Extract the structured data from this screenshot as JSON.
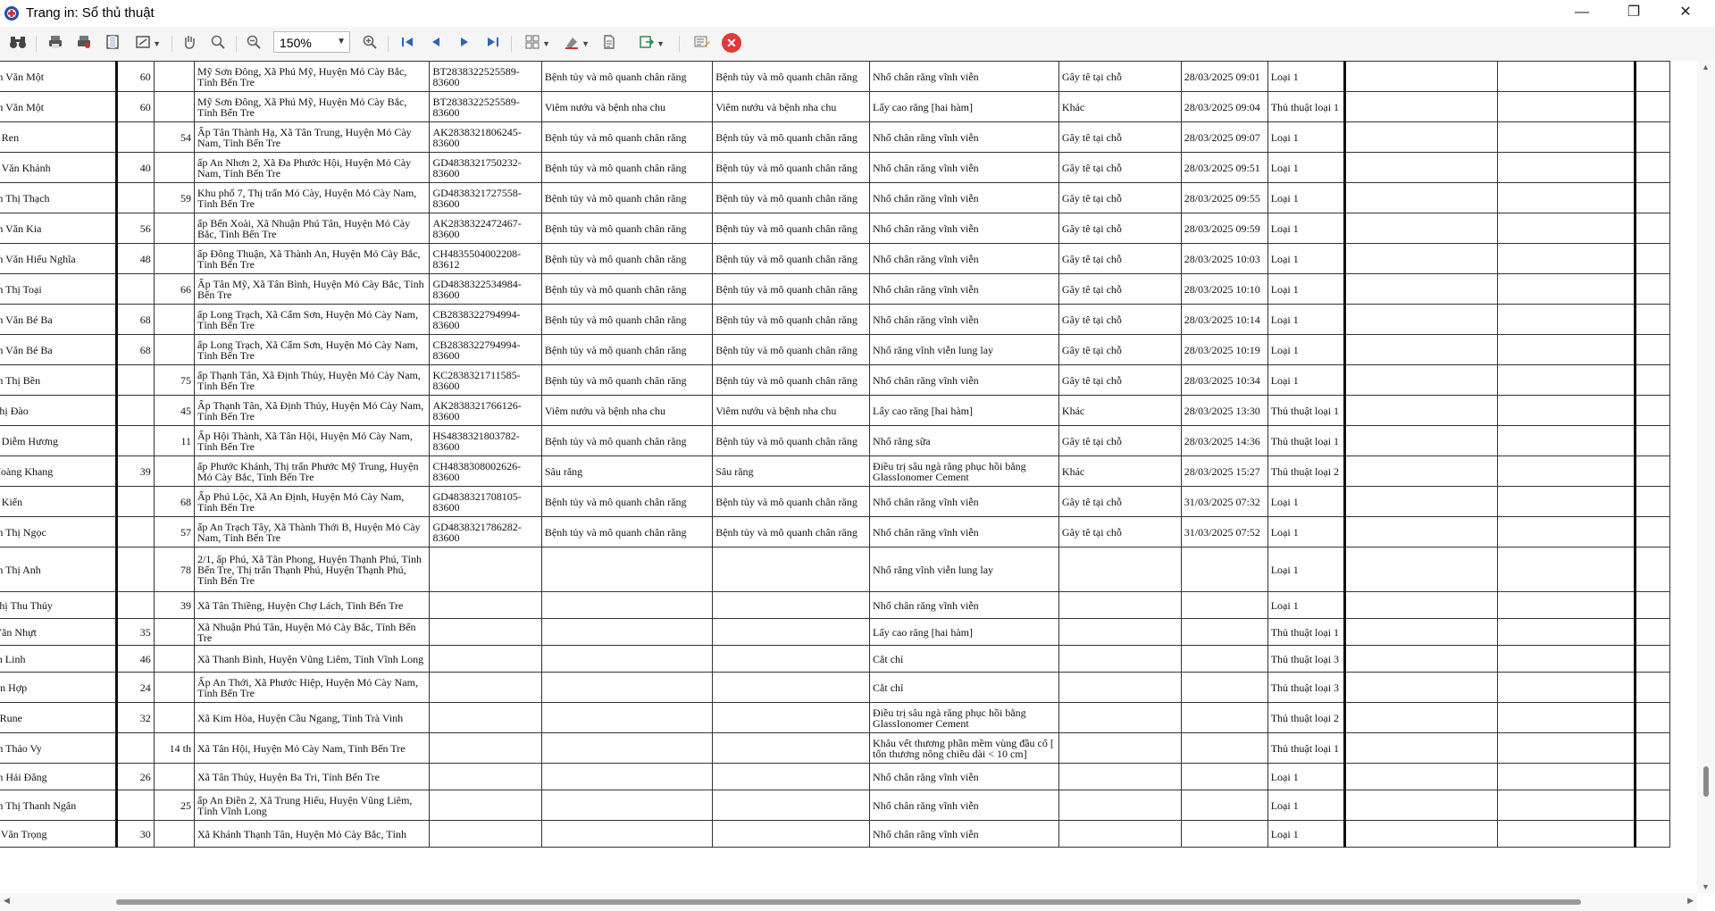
{
  "window": {
    "title": "Trang in: Sổ thủ thuật",
    "minimize": "—",
    "maximize": "❐",
    "close": "✕"
  },
  "toolbar": {
    "zoom_value": "150%",
    "icons": [
      "binoculars-icon",
      "print-icon",
      "print-setup-icon",
      "page-layout-icon",
      "fit-page-icon",
      "hand-icon",
      "zoom-in-icon",
      "zoom-out-icon",
      "zoom-combo",
      "zoom-plus-icon",
      "first-page-icon",
      "prev-page-icon",
      "next-page-icon",
      "last-page-icon",
      "multi-page-icon",
      "color-icon",
      "document-icon",
      "export-icon",
      "parameters-icon",
      "close-icon"
    ]
  },
  "report": {
    "rows": [
      {
        "name": "guyễn Văn Một",
        "age1": "60",
        "age2": "",
        "address": "Mỹ Sơn Đông, Xã Phú Mỹ, Huyện Mỏ Cày Bắc, Tỉnh Bến Tre",
        "card": "BT2838322525589-83600",
        "diag1": "Bệnh tủy và mô quanh chân răng",
        "diag2": "Bệnh tủy và mô quanh chân răng",
        "procedure": "Nhổ chân răng vĩnh viễn",
        "method": "Gây tê tại chỗ",
        "datetime": "28/03/2025 09:01",
        "type": "Loại 1"
      },
      {
        "name": "guyễn Văn Một",
        "age1": "60",
        "age2": "",
        "address": "Mỹ Sơn Đông, Xã Phú Mỹ, Huyện Mỏ Cày Bắc, Tỉnh Bến Tre",
        "card": "BT2838322525589-83600",
        "diag1": "Viêm nướu và bệnh nha chu",
        "diag2": "Viêm nướu và bệnh nha chu",
        "procedure": "Lấy cao răng [hai hàm]",
        "method": "Khác",
        "datetime": "28/03/2025 09:04",
        "type": "Thủ thuật loại 1"
      },
      {
        "name": "ê Thị Ren",
        "age1": "",
        "age2": "54",
        "address": "Ấp Tân Thành Hạ, Xã Tân Trung, Huyện Mỏ Cày Nam, Tỉnh Bến Tre",
        "card": "AK2838321806245-83600",
        "diag1": "Bệnh tủy và mô quanh chân răng",
        "diag2": "Bệnh tủy và mô quanh chân răng",
        "procedure": "Nhổ chân răng vĩnh viễn",
        "method": "Gây tê tại chỗ",
        "datetime": "28/03/2025 09:07",
        "type": "Loại 1"
      },
      {
        "name": "ương Văn Khánh",
        "age1": "40",
        "age2": "",
        "address": "ấp An Nhơn 2, Xã Đa Phước Hội, Huyện Mỏ Cày Nam, Tỉnh Bến Tre",
        "card": "GD4838321750232-83600",
        "diag1": "Bệnh tủy và mô quanh chân răng",
        "diag2": "Bệnh tủy và mô quanh chân răng",
        "procedure": "Nhổ chân răng vĩnh viễn",
        "method": "Gây tê tại chỗ",
        "datetime": "28/03/2025 09:51",
        "type": "Loại 1"
      },
      {
        "name": "guyễn Thị Thạch",
        "age1": "",
        "age2": "59",
        "address": "Khu phố 7, Thị trấn Mỏ Cày, Huyện Mỏ Cày Nam, Tỉnh Bến Tre",
        "card": "GD4838321727558-83600",
        "diag1": "Bệnh tủy và mô quanh chân răng",
        "diag2": "Bệnh tủy và mô quanh chân răng",
        "procedure": "Nhổ chân răng vĩnh viễn",
        "method": "Gây tê tại chỗ",
        "datetime": "28/03/2025 09:55",
        "type": "Loại 1"
      },
      {
        "name": "guyễn Văn Kia",
        "age1": "56",
        "age2": "",
        "address": "ấp Bến Xoài, Xã Nhuận Phú Tân, Huyện Mỏ Cày Bắc, Tỉnh Bến Tre",
        "card": "AK2838322472467-83600",
        "diag1": "Bệnh tủy và mô quanh chân răng",
        "diag2": "Bệnh tủy và mô quanh chân răng",
        "procedure": "Nhổ chân răng vĩnh viễn",
        "method": "Gây tê tại chỗ",
        "datetime": "28/03/2025 09:59",
        "type": "Loại 1"
      },
      {
        "name": "guyễn Văn Hiếu Nghĩa",
        "age1": "48",
        "age2": "",
        "address": "ấp Đông Thuận, Xã Thành An, Huyện Mỏ Cày Bắc, Tỉnh Bến Tre",
        "card": "CH4835504002208-83612",
        "diag1": "Bệnh tủy và mô quanh chân răng",
        "diag2": "Bệnh tủy và mô quanh chân răng",
        "procedure": "Nhổ chân răng vĩnh viễn",
        "method": "Gây tê tại chỗ",
        "datetime": "28/03/2025 10:03",
        "type": "Loại 1"
      },
      {
        "name": "guyễn Thị Toại",
        "age1": "",
        "age2": "66",
        "address": "Ấp Tân Mỹ, Xã Tân Bình, Huyện Mỏ Cày Bắc, Tỉnh Bến Tre",
        "card": "GD4838322534984-83600",
        "diag1": "Bệnh tủy và mô quanh chân răng",
        "diag2": "Bệnh tủy và mô quanh chân răng",
        "procedure": "Nhổ chân răng vĩnh viễn",
        "method": "Gây tê tại chỗ",
        "datetime": "28/03/2025 10:10",
        "type": "Loại 1"
      },
      {
        "name": "guyễn Văn Bé Ba",
        "age1": "68",
        "age2": "",
        "address": "ấp Long Trạch, Xã Cẩm Sơn, Huyện Mỏ Cày Nam, Tỉnh Bến Tre",
        "card": "CB2838322794994-83600",
        "diag1": "Bệnh tủy và mô quanh chân răng",
        "diag2": "Bệnh tủy và mô quanh chân răng",
        "procedure": "Nhổ chân răng vĩnh viễn",
        "method": "Gây tê tại chỗ",
        "datetime": "28/03/2025 10:14",
        "type": "Loại 1"
      },
      {
        "name": "guyễn Văn Bé Ba",
        "age1": "68",
        "age2": "",
        "address": "ấp Long Trạch, Xã Cẩm Sơn, Huyện Mỏ Cày Nam, Tỉnh Bến Tre",
        "card": "CB2838322794994-83600",
        "diag1": "Bệnh tủy và mô quanh chân răng",
        "diag2": "Bệnh tủy và mô quanh chân răng",
        "procedure": "Nhổ răng vĩnh viễn lung lay",
        "method": "Gây tê tại chỗ",
        "datetime": "28/03/2025 10:19",
        "type": "Loại 1"
      },
      {
        "name": "guyễn Thị Bền",
        "age1": "",
        "age2": "75",
        "address": "ấp Thạnh Tân, Xã Định Thủy, Huyện Mỏ Cày Nam, Tỉnh Bến Tre",
        "card": "KC2838321711585-83600",
        "diag1": "Bệnh tủy và mô quanh chân răng",
        "diag2": "Bệnh tủy và mô quanh chân răng",
        "procedure": "Nhổ chân răng vĩnh viễn",
        "method": "Gây tê tại chỗ",
        "datetime": "28/03/2025 10:34",
        "type": "Loại 1"
      },
      {
        "name": "rần Thị Đào",
        "age1": "",
        "age2": "45",
        "address": "Ấp Thạnh Tân, Xã Định Thủy, Huyện Mỏ Cày Nam, Tỉnh Bến Tre",
        "card": "AK2838321766126-83600",
        "diag1": "Viêm nướu và bệnh nha chu",
        "diag2": "Viêm nướu và bệnh nha chu",
        "procedure": "Lấy cao răng [hai hàm]",
        "method": "Khác",
        "datetime": "28/03/2025 13:30",
        "type": "Thủ thuật loại 1"
      },
      {
        "name": "ê Thị Diễm Hương",
        "age1": "",
        "age2": "11",
        "address": "Ấp Hội Thành, Xã Tân Hội, Huyện Mỏ Cày Nam, Tỉnh Bến Tre",
        "card": "HS4838321803782-83600",
        "diag1": "Bệnh tủy và mô quanh chân răng",
        "diag2": "Bệnh tủy và mô quanh chân răng",
        "procedure": "Nhổ răng sữa",
        "method": "Gây tê tại chỗ",
        "datetime": "28/03/2025 14:36",
        "type": "Thủ thuật loại 1"
      },
      {
        "name": "rần Hoàng Khang",
        "age1": "39",
        "age2": "",
        "address": "ấp Phước Khánh, Thị trấn Phước Mỹ Trung, Huyện Mỏ Cày Bắc, Tỉnh Bến Tre",
        "card": "CH4838308002626-83600",
        "diag1": "Sâu răng",
        "diag2": "Sâu răng",
        "procedure": "Điều trị sâu ngà răng phục hồi bằng GlassIonomer Cement",
        "method": "Khác",
        "datetime": "28/03/2025 15:27",
        "type": "Thủ thuật loại 2"
      },
      {
        "name": "ê Thị Kiển",
        "age1": "",
        "age2": "68",
        "address": "Ấp Phú Lộc, Xã An Định, Huyện Mỏ Cày Nam, Tỉnh Bến Tre",
        "card": "GD4838321708105-83600",
        "diag1": "Bệnh tủy và mô quanh chân răng",
        "diag2": "Bệnh tủy và mô quanh chân răng",
        "procedure": "Nhổ chân răng vĩnh viễn",
        "method": "Gây tê tại chỗ",
        "datetime": "31/03/2025 07:32",
        "type": "Loại 1"
      },
      {
        "name": "guyễn Thị Ngọc",
        "age1": "",
        "age2": "57",
        "address": "ấp An Trạch Tây, Xã Thành Thới B, Huyện Mỏ Cày Nam, Tỉnh Bến Tre",
        "card": "GD4838321786282-83600",
        "diag1": "Bệnh tủy và mô quanh chân răng",
        "diag2": "Bệnh tủy và mô quanh chân răng",
        "procedure": "Nhổ chân răng vĩnh viễn",
        "method": "Gây tê tại chỗ",
        "datetime": "31/03/2025 07:52",
        "type": "Loại 1"
      },
      {
        "name": "guyễn Thị Anh",
        "age1": "",
        "age2": "78",
        "address": "2/1, ấp Phú, Xã Tân Phong, Huyện Thạnh Phú, Tỉnh Bến Tre, Thị trấn Thạnh Phú, Huyện Thạnh Phú, Tỉnh Bến Tre",
        "card": "",
        "diag1": "",
        "diag2": "",
        "procedure": "Nhổ răng vĩnh viễn lung lay",
        "method": "",
        "datetime": "",
        "type": "Loại 1"
      },
      {
        "name": "rần Thị Thu Thủy",
        "age1": "",
        "age2": "39",
        "address": "Xã Tân Thiềng, Huyện Chợ Lách, Tỉnh Bến Tre",
        "card": "",
        "diag1": "",
        "diag2": "",
        "procedure": "Nhổ chân răng vĩnh viễn",
        "method": "",
        "datetime": "",
        "type": "Loại 1"
      },
      {
        "name": "ạch Văn Nhựt",
        "age1": "35",
        "age2": "",
        "address": "Xã Nhuận Phú Tân, Huyện Mỏ Cày Bắc, Tỉnh Bến Tre",
        "card": "",
        "diag1": "",
        "diag2": "",
        "procedure": "Lấy cao răng [hai hàm]",
        "method": "",
        "datetime": "",
        "type": "Thủ thuật loại 1"
      },
      {
        "name": "õ Văn Linh",
        "age1": "46",
        "age2": "",
        "address": "Xã Thanh Bình, Huyện Vũng Liêm, Tỉnh Vĩnh Long",
        "card": "",
        "diag1": "",
        "diag2": "",
        "procedure": "Cắt chỉ",
        "method": "",
        "datetime": "",
        "type": "Thủ thuật loại 3"
      },
      {
        "name": "ùi Văn Hợp",
        "age1": "24",
        "age2": "",
        "address": "Ấp An Thới, Xã Phước Hiệp, Huyện Mỏ Cày Nam, Tỉnh Bến Tre",
        "card": "",
        "diag1": "",
        "diag2": "",
        "procedure": "Cắt chỉ",
        "method": "",
        "datetime": "",
        "type": "Thủ thuật loại 3"
      },
      {
        "name": "hạch Rune",
        "age1": "32",
        "age2": "",
        "address": "Xã Kim Hòa, Huyện Cầu Ngang, Tỉnh Trà Vinh",
        "card": "",
        "diag1": "",
        "diag2": "",
        "procedure": "Điều trị sâu ngà răng phục hồi bằng GlassIonomer Cement",
        "method": "",
        "datetime": "",
        "type": "Thủ thuật loại 2"
      },
      {
        "name": "guyễn Thảo Vy",
        "age1": "",
        "age2": "14 th",
        "address": "Xã Tân Hội, Huyện Mỏ Cày Nam, Tỉnh Bến Tre",
        "card": "",
        "diag1": "",
        "diag2": "",
        "procedure": "Khâu vết thương phần mềm vùng đầu cổ [ tổn thương nông chiều dài < 10 cm]",
        "method": "",
        "datetime": "",
        "type": "Thủ thuật loại 1"
      },
      {
        "name": "guyễn Hải Đăng",
        "age1": "26",
        "age2": "",
        "address": "Xã Tân Thủy, Huyện Ba Tri, Tỉnh Bến Tre",
        "card": "",
        "diag1": "",
        "diag2": "",
        "procedure": "Nhổ chân răng vĩnh viễn",
        "method": "",
        "datetime": "",
        "type": "Loại 1"
      },
      {
        "name": "guyễn Thị Thanh Ngân",
        "age1": "",
        "age2": "25",
        "address": "ấp An Điền 2, Xã Trung Hiếu, Huyện Vũng Liêm, Tỉnh Vĩnh Long",
        "card": "",
        "diag1": "",
        "diag2": "",
        "procedure": "Nhổ chân răng vĩnh viễn",
        "method": "",
        "datetime": "",
        "type": "Loại 1"
      },
      {
        "name": "hùng Văn Trọng",
        "age1": "30",
        "age2": "",
        "address": "Xã Khánh Thạnh Tân, Huyện Mỏ Cày Bắc, Tỉnh",
        "card": "",
        "diag1": "",
        "diag2": "",
        "procedure": "Nhổ chân răng vĩnh viễn",
        "method": "",
        "datetime": "",
        "type": "Loại 1"
      }
    ]
  }
}
